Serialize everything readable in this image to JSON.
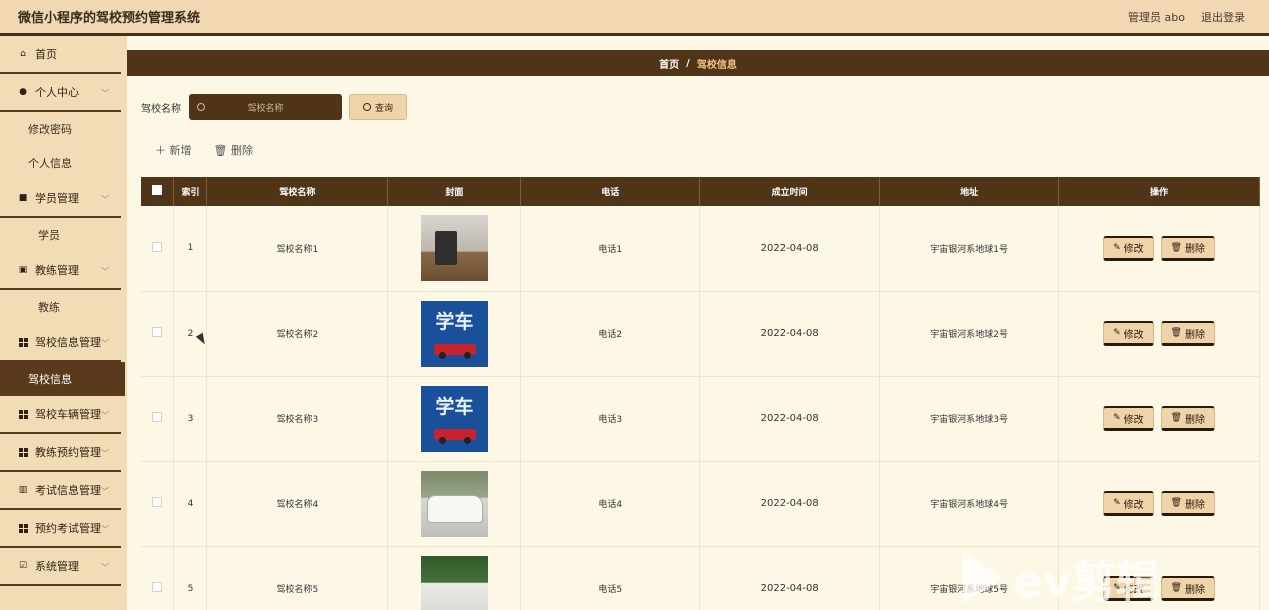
{
  "header": {
    "title": "微信小程序的驾校预约管理系统",
    "admin": "管理员 abo",
    "logout": "退出登录"
  },
  "sidebar": {
    "home": "首页",
    "personal_center": "个人中心",
    "change_password": "修改密码",
    "personal_info": "个人信息",
    "student_mgmt": "学员管理",
    "student": "学员",
    "coach_mgmt": "教练管理",
    "coach": "教练",
    "school_info_mgmt": "驾校信息管理",
    "school_info": "驾校信息",
    "vehicle_mgmt": "驾校车辆管理",
    "coach_booking_mgmt": "教练预约管理",
    "exam_info_mgmt": "考试信息管理",
    "exam_booking_mgmt": "预约考试管理",
    "system_mgmt": "系统管理"
  },
  "breadcrumb": {
    "home": "首页",
    "separator": "/",
    "current": "驾校信息"
  },
  "search": {
    "label": "驾校名称",
    "placeholder": "驾校名称",
    "button": "查询"
  },
  "actions": {
    "add": "新增",
    "delete": "删除"
  },
  "table": {
    "columns": {
      "index": "索引",
      "name": "驾校名称",
      "cover": "封面",
      "phone": "电话",
      "founded": "成立时间",
      "address": "地址",
      "ops": "操作"
    },
    "edit_label": "修改",
    "delete_label": "删除",
    "rows": [
      {
        "index": "1",
        "name": "驾校名称1",
        "cover": "room",
        "phone": "电话1",
        "founded": "2022-04-08",
        "address": "宇宙银河系地球1号"
      },
      {
        "index": "2",
        "name": "驾校名称2",
        "cover": "sign",
        "phone": "电话2",
        "founded": "2022-04-08",
        "address": "宇宙银河系地球2号"
      },
      {
        "index": "3",
        "name": "驾校名称3",
        "cover": "sign",
        "phone": "电话3",
        "founded": "2022-04-08",
        "address": "宇宙银河系地球3号"
      },
      {
        "index": "4",
        "name": "驾校名称4",
        "cover": "taxi",
        "phone": "电话4",
        "founded": "2022-04-08",
        "address": "宇宙银河系地球4号"
      },
      {
        "index": "5",
        "name": "驾校名称5",
        "cover": "fleet",
        "phone": "电话5",
        "founded": "2022-04-08",
        "address": "宇宙银河系地球5号"
      }
    ]
  },
  "cover_sign_text": "学车",
  "watermark": "ev剪辑",
  "colors": {
    "header_bg": "#f1d8b3",
    "dark_brown": "#4f3418",
    "accent_tan": "#efd3a9",
    "page_bg": "#fdf7e6"
  }
}
